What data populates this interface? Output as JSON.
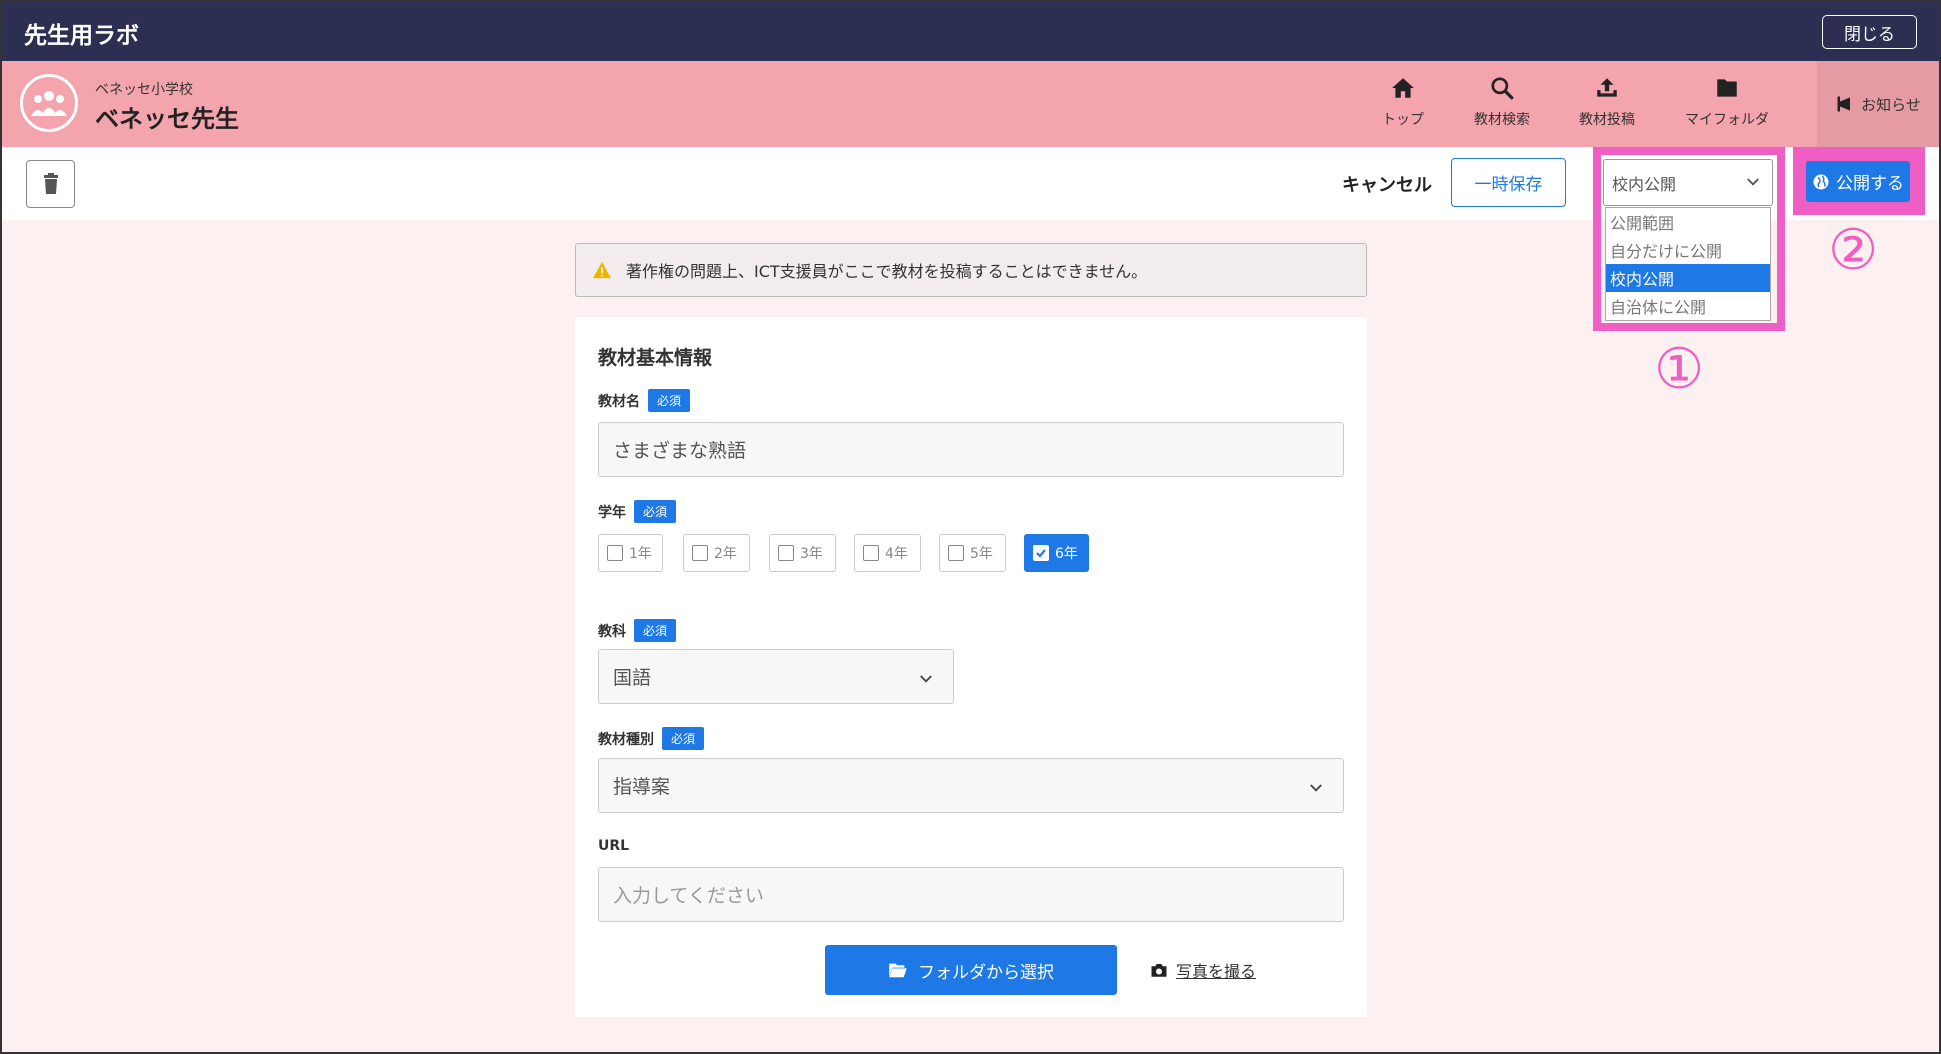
{
  "app": {
    "title": "先生用ラボ",
    "close_label": "閉じる"
  },
  "header": {
    "school": "ベネッセ小学校",
    "teacher": "ベネッセ先生",
    "nav": [
      {
        "label": "トップ",
        "icon": "home-icon"
      },
      {
        "label": "教材検索",
        "icon": "search-icon"
      },
      {
        "label": "教材投稿",
        "icon": "upload-icon"
      },
      {
        "label": "マイフォルダ",
        "icon": "folder-icon"
      }
    ],
    "notice_label": "お知らせ"
  },
  "toolbar": {
    "cancel_label": "キャンセル",
    "save_label": "一時保存",
    "visibility": {
      "selected": "校内公開",
      "options": [
        "公開範囲",
        "自分だけに公開",
        "校内公開",
        "自治体に公開"
      ]
    },
    "publish_label": "公開する"
  },
  "markers": {
    "one": "①",
    "two": "②"
  },
  "warning": "著作権の問題上、ICT支援員がここで教材を投稿することはできません。",
  "form": {
    "section_title": "教材基本情報",
    "required_badge": "必須",
    "name_label": "教材名",
    "name_value": "さまざまな熟語",
    "grade_label": "学年",
    "grades": [
      "1年",
      "2年",
      "3年",
      "4年",
      "5年",
      "6年"
    ],
    "grade_selected": "6年",
    "subject_label": "教科",
    "subject_value": "国語",
    "type_label": "教材種別",
    "type_value": "指導案",
    "url_label": "URL",
    "url_placeholder": "入力してください",
    "folder_button": "フォルダから選択",
    "photo_link": "写真を撮る"
  },
  "colors": {
    "topbar": "#2c2f52",
    "header": "#f4a4ad",
    "accent": "#1e78e6",
    "highlight": "#ee5ec3"
  }
}
